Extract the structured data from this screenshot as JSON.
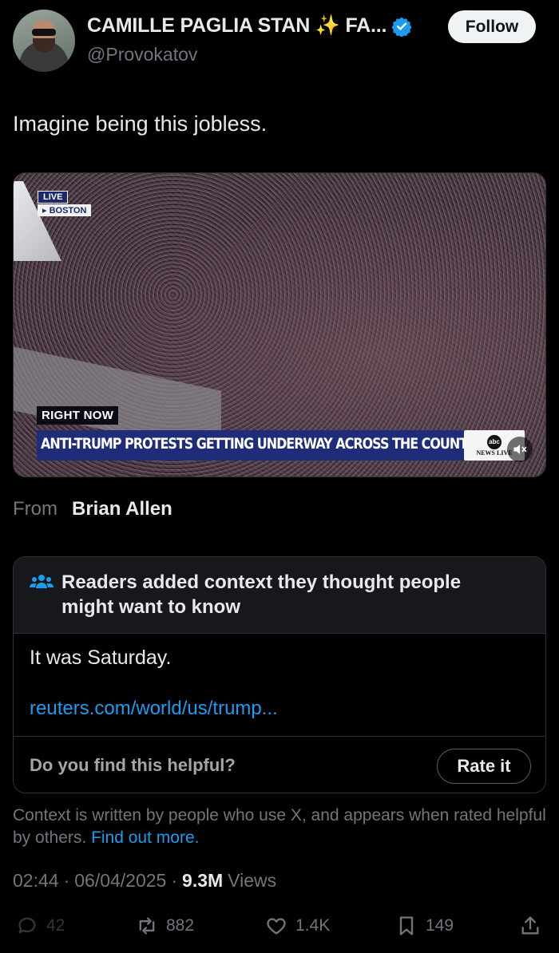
{
  "author": {
    "name": "CAMILLE PAGLIA STAN ✨ FA...",
    "handle": "@Provokatov",
    "follow_label": "Follow",
    "verified_color": "#1d9bf0"
  },
  "tweet": {
    "text": "Imagine being this jobless."
  },
  "video": {
    "live_label": "LIVE",
    "location_label": "▸ BOSTON",
    "right_now_label": "RIGHT NOW",
    "headline": "ANTI-TRUMP PROTESTS GETTING UNDERWAY ACROSS THE COUNTRY",
    "network_logo_text": "abc",
    "network_sub_text": "NEWS LIVE",
    "mute_icon": "speaker-muted-icon"
  },
  "source": {
    "from_label": "From",
    "from_name": "Brian Allen"
  },
  "community_note": {
    "title": "Readers added context they thought people might want to know",
    "body": "It was Saturday.",
    "link": "reuters.com/world/us/trump...",
    "helpful_prompt": "Do you find this helpful?",
    "rate_label": "Rate it"
  },
  "context_disclaimer": {
    "text": "Context is written by people who use X, and appears when rated helpful by others.",
    "link_text": "Find out more."
  },
  "meta": {
    "time": "02:44",
    "date": "06/04/2025",
    "views_count": "9.3M",
    "views_label": "Views",
    "separator": "·"
  },
  "actions": {
    "replies": "42",
    "reposts": "882",
    "likes": "1.4K",
    "bookmarks": "149"
  }
}
